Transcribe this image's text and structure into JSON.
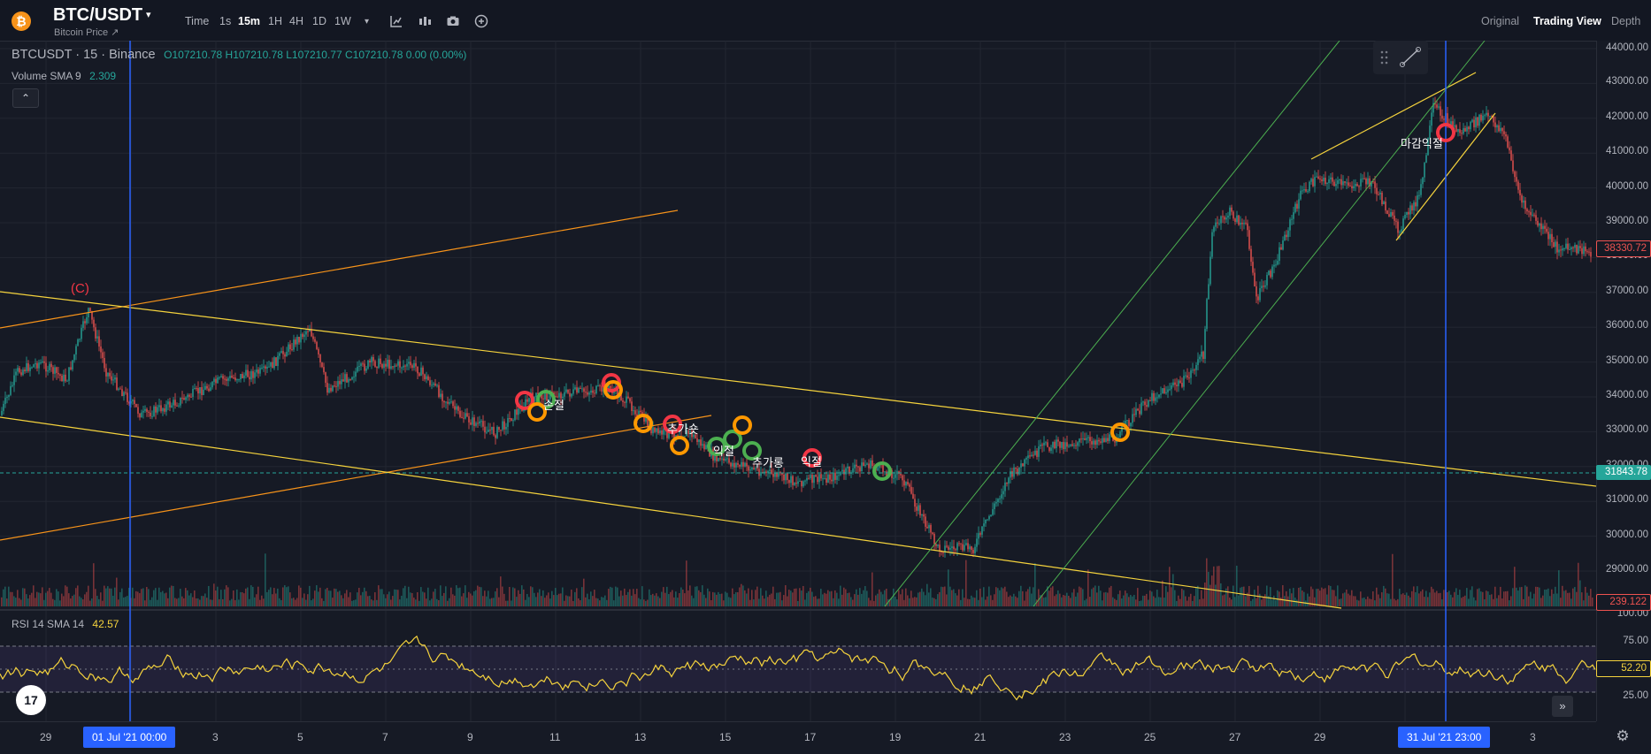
{
  "header": {
    "logo_glyph": "₿",
    "symbol": "BTC/USDT",
    "symbol_caret": "▾",
    "subtitle": "Bitcoin Price ↗",
    "time_label": "Time",
    "timeframes": [
      "1s",
      "15m",
      "1H",
      "4H",
      "1D",
      "1W"
    ],
    "active_timeframe": "15m",
    "more_caret": "▾",
    "view_tabs": [
      "Original",
      "Trading View",
      "Depth"
    ],
    "active_view": "Trading View",
    "icons": [
      "indicators-icon",
      "chart-type-icon",
      "screenshot-icon",
      "add-icon"
    ]
  },
  "legend": {
    "title": "BTCUSDT · 15 · Binance",
    "ohlc": "O107210.78 H107210.78 L107210.77 C107210.78 0.00 (0.00%)",
    "volume_label": "Volume SMA 9",
    "volume_value": "2.309",
    "rsi_label": "RSI 14 SMA 14",
    "rsi_value": "42.57",
    "collapse_glyph": "⌃"
  },
  "price_axis": {
    "labels": [
      "44000.00",
      "43000.00",
      "42000.00",
      "41000.00",
      "40000.00",
      "39000.00",
      "38000.00",
      "37000.00",
      "36000.00",
      "35000.00",
      "34000.00",
      "33000.00",
      "32000.00",
      "31000.00",
      "30000.00",
      "29000.00"
    ],
    "last_price_tag": "38330.72",
    "level_tag": "31843.78",
    "volume_tag": "239.122",
    "rsi_labels": [
      "100.00",
      "75.00",
      "25.00"
    ],
    "rsi_tag": "52.20"
  },
  "time_axis": {
    "labels": [
      "29",
      "3",
      "5",
      "7",
      "9",
      "11",
      "13",
      "15",
      "17",
      "19",
      "21",
      "23",
      "25",
      "27",
      "29",
      "3"
    ],
    "tag_left": "01 Jul '21   00:00",
    "tag_right": "31 Jul '21   23:00"
  },
  "annotations": {
    "wave_label": "(C)",
    "notes": [
      "손절",
      "추가숏",
      "익절",
      "추가롱",
      "익절",
      "마감익절"
    ]
  },
  "colors": {
    "up": "#26a69a",
    "down": "#ef5350",
    "trendline": "#f5d33d",
    "fan": "#f7931a",
    "channel": "#4caf50",
    "marker_red": "#f23645",
    "marker_green": "#4caf50",
    "marker_orange": "#ff9800",
    "crosshair": "#2962ff"
  },
  "footer": {
    "tv_logo": "17",
    "scroll_glyph": "»",
    "settings_glyph": "⚙"
  }
}
